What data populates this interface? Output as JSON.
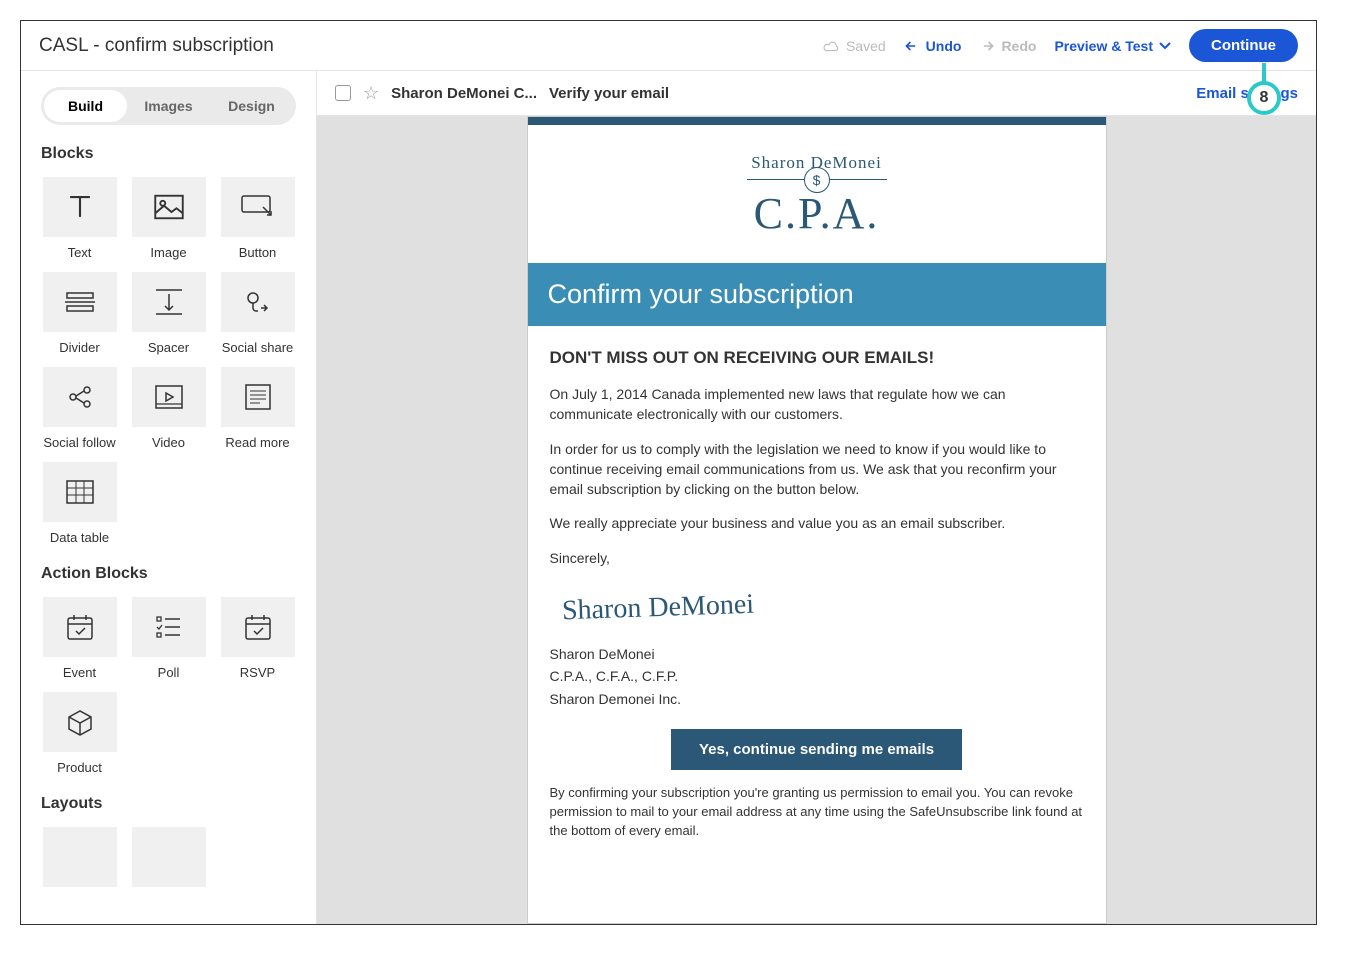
{
  "topbar": {
    "title": "CASL - confirm subscription",
    "saved": "Saved",
    "undo": "Undo",
    "redo": "Redo",
    "preview": "Preview & Test",
    "continue": "Continue"
  },
  "sidebar": {
    "tabs": [
      "Build",
      "Images",
      "Design"
    ],
    "activeTab": 0,
    "blocksHeader": "Blocks",
    "blocks": [
      {
        "label": "Text",
        "icon": "text"
      },
      {
        "label": "Image",
        "icon": "image"
      },
      {
        "label": "Button",
        "icon": "button"
      },
      {
        "label": "Divider",
        "icon": "divider"
      },
      {
        "label": "Spacer",
        "icon": "spacer"
      },
      {
        "label": "Social share",
        "icon": "socialshare"
      },
      {
        "label": "Social follow",
        "icon": "socialfollow"
      },
      {
        "label": "Video",
        "icon": "video"
      },
      {
        "label": "Read more",
        "icon": "readmore"
      },
      {
        "label": "Data table",
        "icon": "datatable"
      }
    ],
    "actionBlocksHeader": "Action Blocks",
    "actionBlocks": [
      {
        "label": "Event",
        "icon": "event"
      },
      {
        "label": "Poll",
        "icon": "poll"
      },
      {
        "label": "RSVP",
        "icon": "rsvp"
      },
      {
        "label": "Product",
        "icon": "product"
      }
    ],
    "layoutsHeader": "Layouts"
  },
  "canvasHeader": {
    "from": "Sharon DeMonei C...",
    "subject": "Verify your email",
    "emailSettings": "Email settings"
  },
  "email": {
    "logoName": "Sharon DeMonei",
    "logoCpa": "C.P.A.",
    "banner": "Confirm your subscription",
    "heading": "DON'T MISS OUT ON RECEIVING OUR EMAILS!",
    "p1": "On July 1, 2014 Canada implemented new laws that regulate how we can communicate electronically with our customers.",
    "p2": "In order for us to comply with the legislation we need to know if you would like to continue receiving email communications from us. We ask that you reconfirm your email subscription by clicking on the button below.",
    "p3": "We really appreciate your business and value you as an email subscriber.",
    "p4": "Sincerely,",
    "signature": "Sharon DeMonei",
    "sigLine1": "Sharon DeMonei",
    "sigLine2": "C.P.A., C.F.A., C.F.P.",
    "sigLine3": "Sharon Demonei Inc.",
    "cta": "Yes, continue sending me emails",
    "disclaimer": "By confirming your subscription you're granting us permission to email you. You can revoke permission to mail to your email address at any time using the SafeUnsubscribe link found at the bottom of every email."
  },
  "badge": "8"
}
